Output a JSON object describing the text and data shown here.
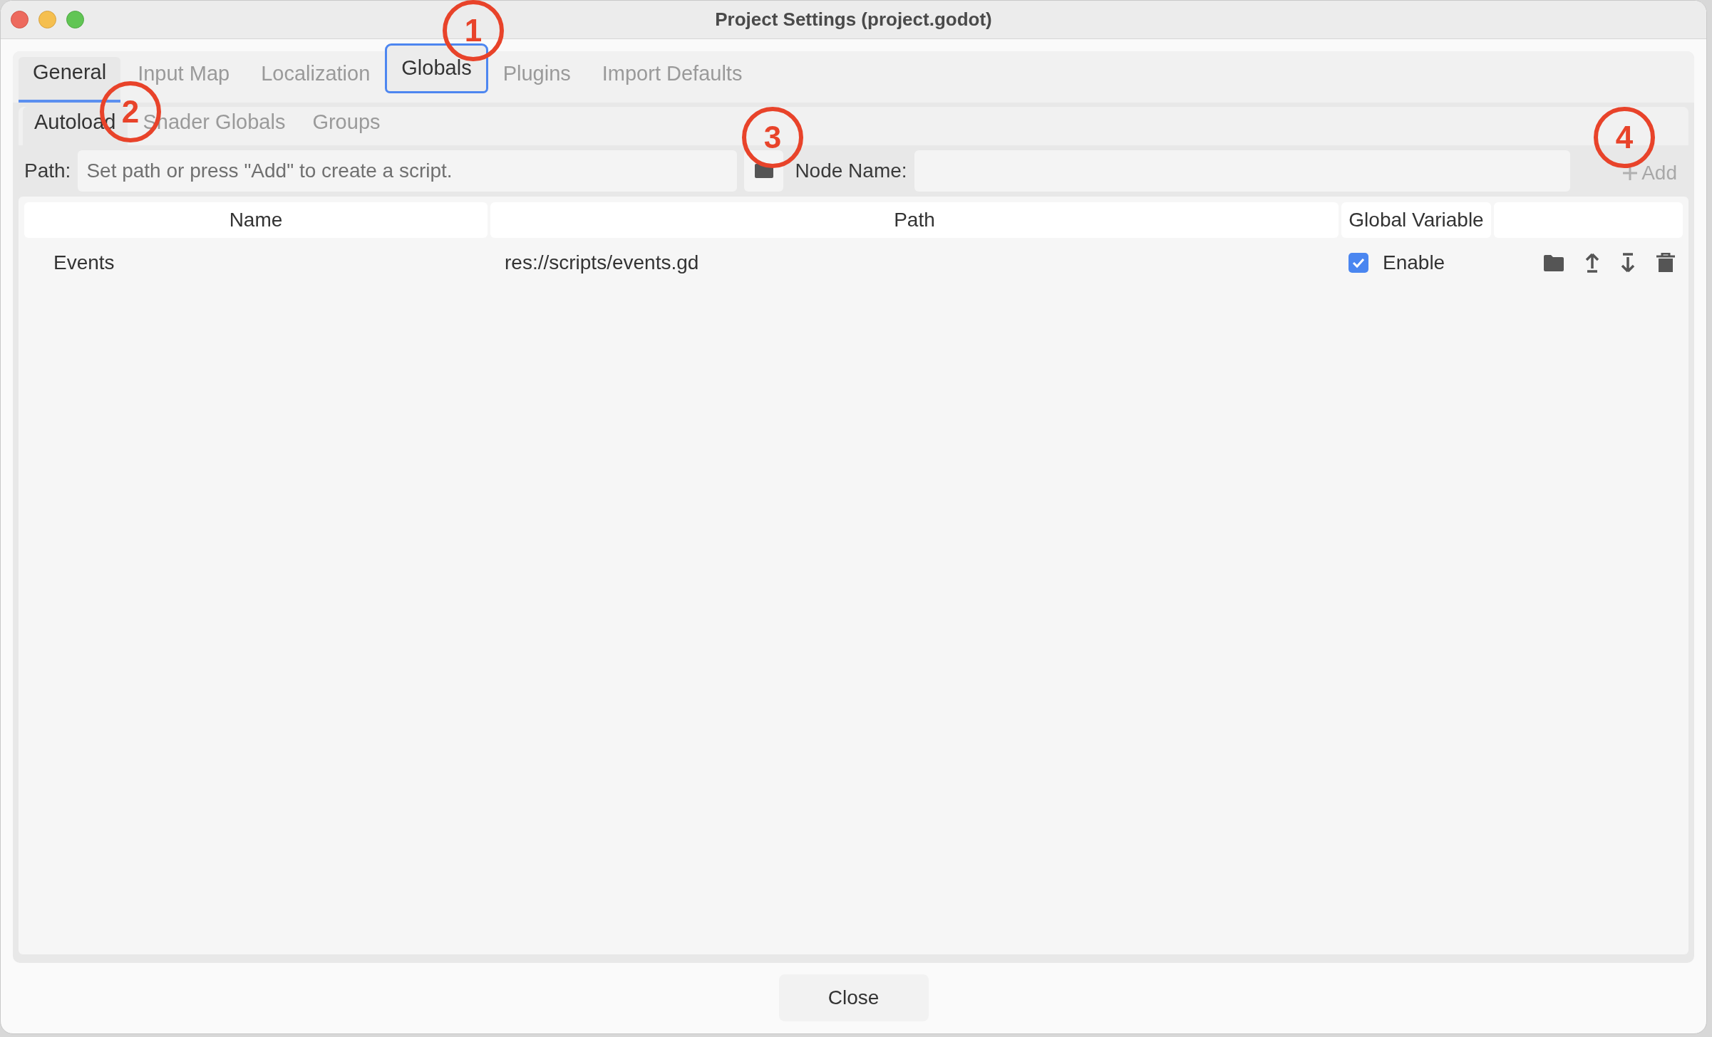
{
  "window": {
    "title": "Project Settings (project.godot)"
  },
  "tabs": [
    {
      "label": "General",
      "selected": true,
      "focused": false
    },
    {
      "label": "Input Map",
      "selected": false,
      "focused": false
    },
    {
      "label": "Localization",
      "selected": false,
      "focused": false
    },
    {
      "label": "Globals",
      "selected": false,
      "focused": true
    },
    {
      "label": "Plugins",
      "selected": false,
      "focused": false
    },
    {
      "label": "Import Defaults",
      "selected": false,
      "focused": false
    }
  ],
  "subtabs": [
    {
      "label": "Autoload",
      "selected": true
    },
    {
      "label": "Shader Globals",
      "selected": false
    },
    {
      "label": "Groups",
      "selected": false
    }
  ],
  "toolbar": {
    "path_label": "Path:",
    "path_placeholder": "Set path or press \"Add\" to create a script.",
    "node_name_label": "Node Name:",
    "add_button": {
      "label": "Add",
      "disabled": true
    }
  },
  "table": {
    "columns": [
      "Name",
      "Path",
      "Global Variable"
    ],
    "rows": [
      {
        "name": "Events",
        "path": "res://scripts/events.gd",
        "enabled": true,
        "enable_label": "Enable"
      }
    ]
  },
  "close_button": "Close",
  "annotations": [
    {
      "label": "1"
    },
    {
      "label": "2"
    },
    {
      "label": "3"
    },
    {
      "label": "4"
    }
  ]
}
